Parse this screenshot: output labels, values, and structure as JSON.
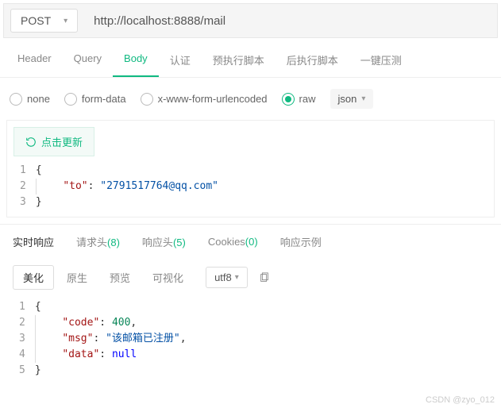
{
  "request": {
    "method": "POST",
    "url": "http://localhost:8888/mail"
  },
  "tabs": {
    "header": "Header",
    "query": "Query",
    "body": "Body",
    "auth": "认证",
    "prescript": "预执行脚本",
    "postscript": "后执行脚本",
    "stress": "一键压测"
  },
  "bodyTypes": {
    "none": "none",
    "form": "form-data",
    "urlenc": "x-www-form-urlencoded",
    "raw": "raw",
    "rawType": "json"
  },
  "refresh": "点击更新",
  "chart_data": {
    "type": "table",
    "request_body_json": {
      "to": "2791517764@qq.com"
    },
    "response_body_json": {
      "code": 400,
      "msg": "该邮箱已注册",
      "data": null
    }
  },
  "reqBody": {
    "ln1": "{",
    "ln2_key": "\"to\"",
    "ln2_val": "\"2791517764@qq.com\"",
    "ln3": "}"
  },
  "respTabs": {
    "live": "实时响应",
    "reqHeaders": "请求头",
    "reqHeadersCount": "(8)",
    "resHeaders": "响应头",
    "resHeadersCount": "(5)",
    "cookies": "Cookies",
    "cookiesCount": "(0)",
    "example": "响应示例"
  },
  "viewModes": {
    "beautify": "美化",
    "raw": "原生",
    "preview": "预览",
    "visual": "可视化",
    "encoding": "utf8"
  },
  "respBody": {
    "ln1": "{",
    "ln2_key": "\"code\"",
    "ln2_val": "400",
    "ln3_key": "\"msg\"",
    "ln3_val": "\"该邮箱已注册\"",
    "ln4_key": "\"data\"",
    "ln4_val": "null",
    "ln5": "}"
  },
  "watermark": "CSDN @zyo_012"
}
